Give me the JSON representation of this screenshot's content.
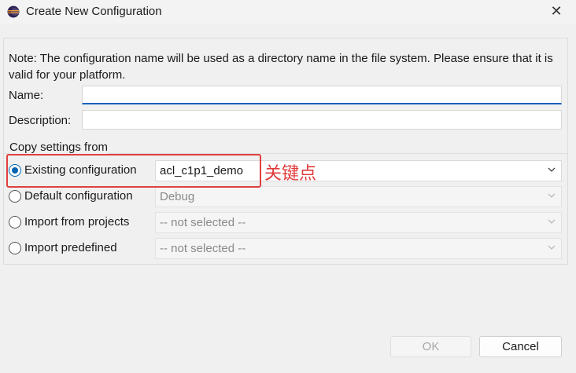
{
  "window": {
    "title": "Create New Configuration",
    "app_icon": "eclipse-icon",
    "close_glyph": "✕"
  },
  "note": "Note: The configuration name will be used as a directory name in the file system.  Please ensure that it is valid for your platform.",
  "fields": {
    "name_label": "Name:",
    "name_value": "",
    "description_label": "Description:",
    "description_value": ""
  },
  "copy_settings": {
    "group_title": "Copy settings from",
    "options": [
      {
        "label": "Existing configuration",
        "value": "acl_c1p1_demo",
        "checked": true,
        "enabled": true
      },
      {
        "label": "Default configuration",
        "value": "Debug",
        "checked": false,
        "enabled": false
      },
      {
        "label": "Import from projects",
        "value": "-- not selected --",
        "checked": false,
        "enabled": false
      },
      {
        "label": "Import predefined",
        "value": "-- not selected --",
        "checked": false,
        "enabled": false
      }
    ]
  },
  "annotation": {
    "text": "关键点",
    "color": "#e03c3c"
  },
  "buttons": {
    "ok_label": "OK",
    "cancel_label": "Cancel"
  },
  "colors": {
    "accent": "#0063b1",
    "highlight": "#e04040"
  }
}
